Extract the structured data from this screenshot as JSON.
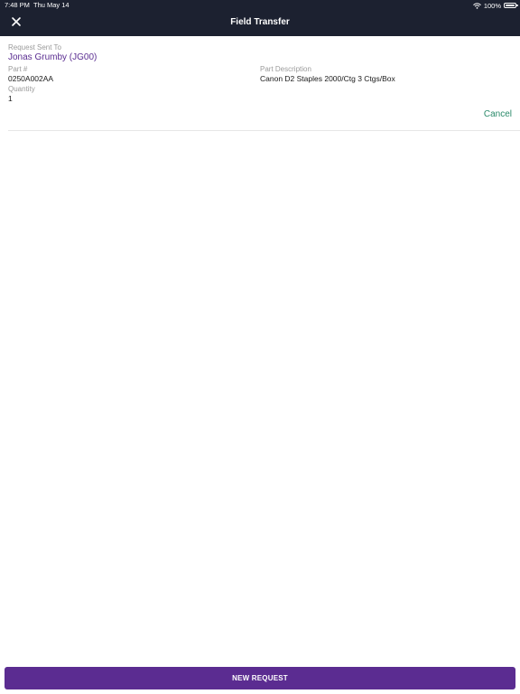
{
  "status_bar": {
    "time": "7:48 PM",
    "date": "Thu May 14",
    "battery": "100%"
  },
  "header": {
    "title": "Field Transfer"
  },
  "request": {
    "sent_to_label": "Request Sent To",
    "sent_to_value": "Jonas Grumby (JG00)",
    "part_label": "Part #",
    "part_value": "0250A002AA",
    "description_label": "Part Description",
    "description_value": "Canon D2 Staples 2000/Ctg 3 Ctgs/Box",
    "quantity_label": "Quantity",
    "quantity_value": "1",
    "cancel_label": "Cancel"
  },
  "footer": {
    "new_request_label": "NEW REQUEST"
  },
  "colors": {
    "header_bg": "#1c2130",
    "accent": "#5b2c91",
    "cancel": "#2a8a6a"
  }
}
